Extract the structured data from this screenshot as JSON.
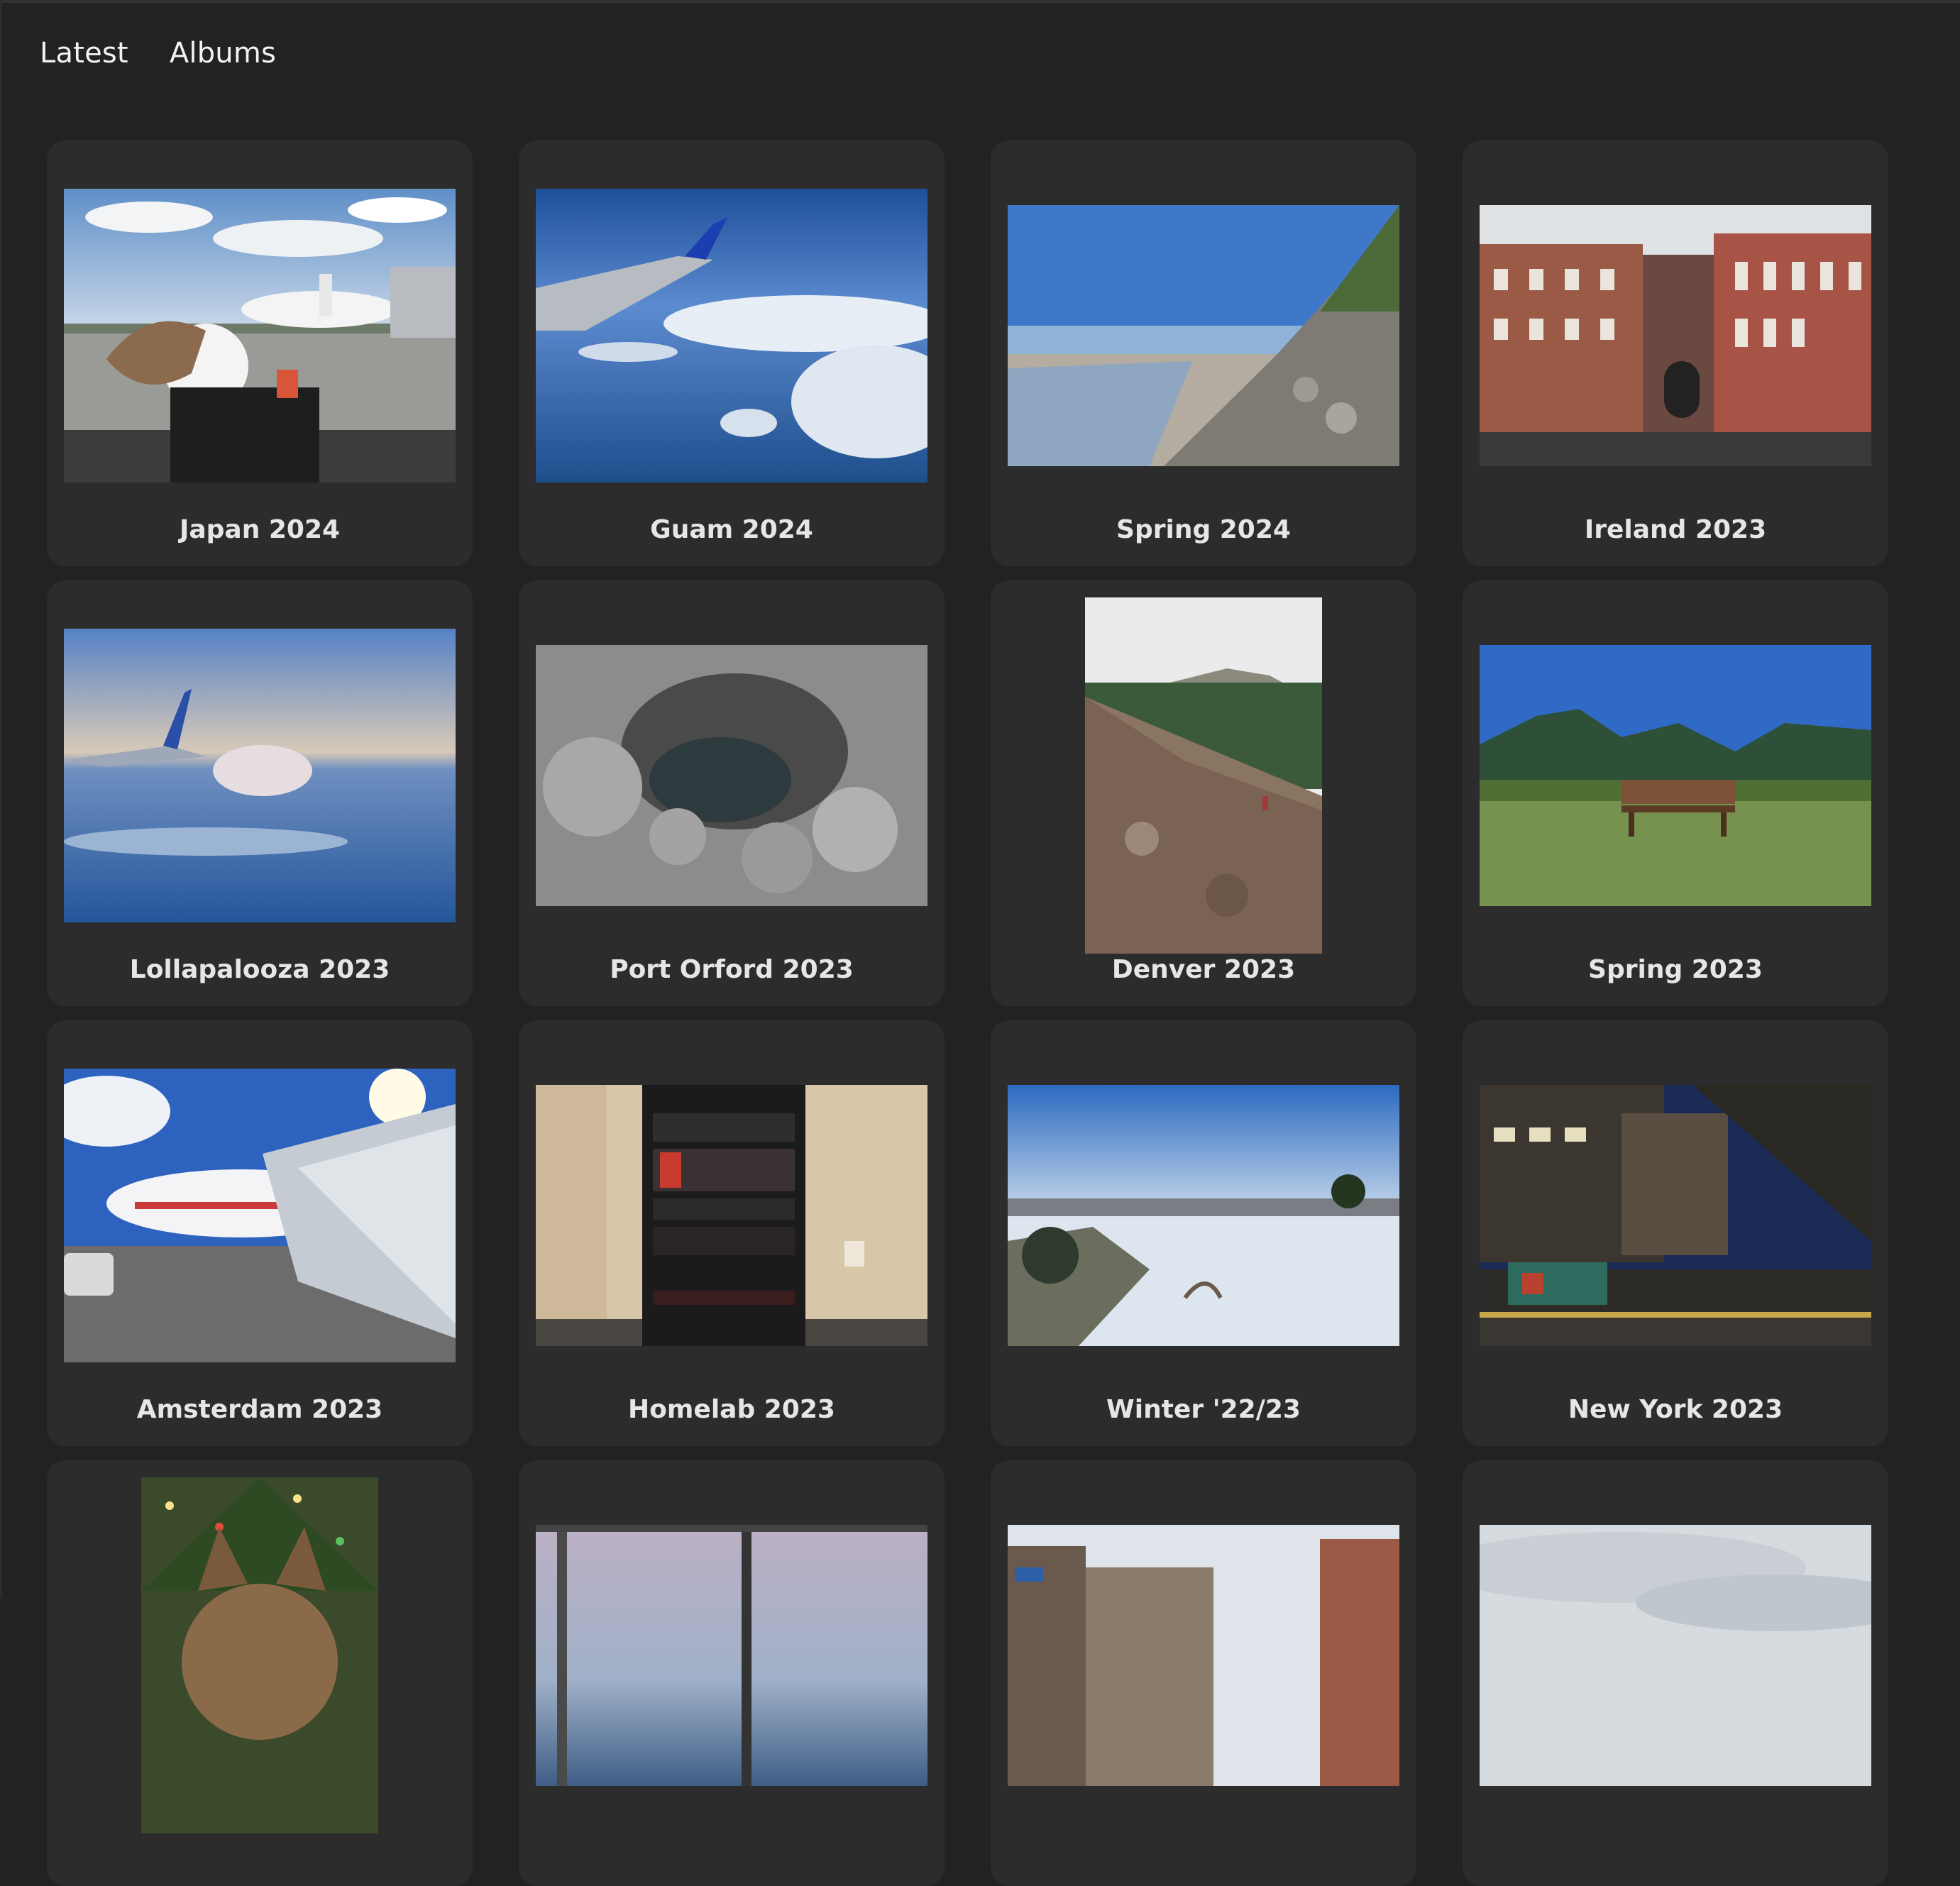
{
  "nav": {
    "latest_label": "Latest",
    "albums_label": "Albums"
  },
  "albums": [
    {
      "title": "Japan 2024",
      "thumbnail": "plane-gate-snoopy-photo"
    },
    {
      "title": "Guam 2024",
      "thumbnail": "wing-over-clouds-photo"
    },
    {
      "title": "Spring 2024",
      "thumbnail": "rocky-beach-photo"
    },
    {
      "title": "Ireland 2023",
      "thumbnail": "brick-building-photo"
    },
    {
      "title": "Lollapalooza 2023",
      "thumbnail": "wing-sunset-photo"
    },
    {
      "title": "Port Orford 2023",
      "thumbnail": "sea-cave-photo"
    },
    {
      "title": "Denver 2023",
      "thumbnail": "boulder-trail-photo"
    },
    {
      "title": "Spring 2023",
      "thumbnail": "bench-mountains-photo"
    },
    {
      "title": "Amsterdam 2023",
      "thumbnail": "british-airways-jet-photo"
    },
    {
      "title": "Homelab 2023",
      "thumbnail": "server-rack-photo"
    },
    {
      "title": "Winter '22/23",
      "thumbnail": "snowy-field-photo"
    },
    {
      "title": "New York 2023",
      "thumbnail": "subway-platform-photo"
    },
    {
      "title": "",
      "thumbnail": "christmas-dog-photo"
    },
    {
      "title": "",
      "thumbnail": "window-dusk-photo"
    },
    {
      "title": "",
      "thumbnail": "street-buildings-photo"
    },
    {
      "title": "",
      "thumbnail": "cloudy-sky-photo"
    }
  ],
  "colors": {
    "background": "#222222",
    "card": "#2c2c2c",
    "text": "#e6e6e6"
  }
}
